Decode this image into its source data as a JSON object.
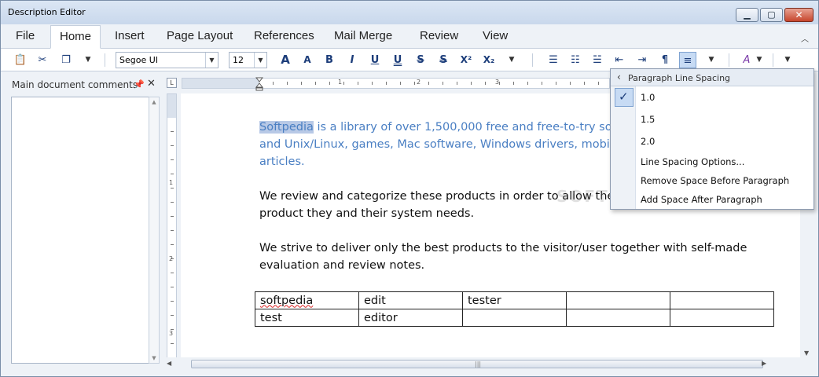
{
  "window": {
    "title": "Description Editor"
  },
  "tabs": [
    "File",
    "Home",
    "Insert",
    "Page Layout",
    "References",
    "Mail Merge",
    "Review",
    "View"
  ],
  "toolbar": {
    "font_name": "Segoe UI",
    "font_size": "12",
    "grow_font": "A",
    "shrink_font": "A",
    "bold": "B",
    "italic": "I",
    "underline": "U",
    "double_underline": "U",
    "strikethrough": "S",
    "double_strike": "S",
    "superscript": "X²",
    "subscript": "X₂",
    "show_marks": "¶"
  },
  "comments_pane": {
    "title": "Main document comments"
  },
  "ruler": {
    "h_numbers": [
      "1",
      "2",
      "3"
    ],
    "v_numbers": [
      "1",
      "2",
      "3"
    ]
  },
  "document": {
    "p1_highlight": "Softpedia",
    "p1_line1_rest": " is a library of over 1,500,000 free and free-to-try softw",
    "p1_line2": "and Unix/Linux, games, Mac software, Windows drivers, mobile d",
    "p1_line3": "articles.",
    "p2_line1": "We review and categorize these products in order to allow the vis",
    "p2_line2": "product they and their system needs.",
    "p3_line1": "We strive to deliver only the best products to the visitor/user together with self-made",
    "p3_line2": "evaluation and review notes.",
    "table": [
      [
        "softpedia",
        "edit",
        "tester",
        "",
        ""
      ],
      [
        "test",
        "editor",
        "",
        "",
        ""
      ]
    ]
  },
  "popup": {
    "title": "Paragraph Line Spacing",
    "items": [
      "1.0",
      "1.5",
      "2.0",
      "Line Spacing Options...",
      "Remove Space Before Paragraph",
      "Add Space After Paragraph"
    ],
    "selected": "1.0"
  },
  "watermark": "SOFTPEDIA",
  "colors": {
    "doc_text_blue": "#4a7fc3",
    "selection": "#b8c9e6",
    "accent": "#1c3d7a"
  }
}
